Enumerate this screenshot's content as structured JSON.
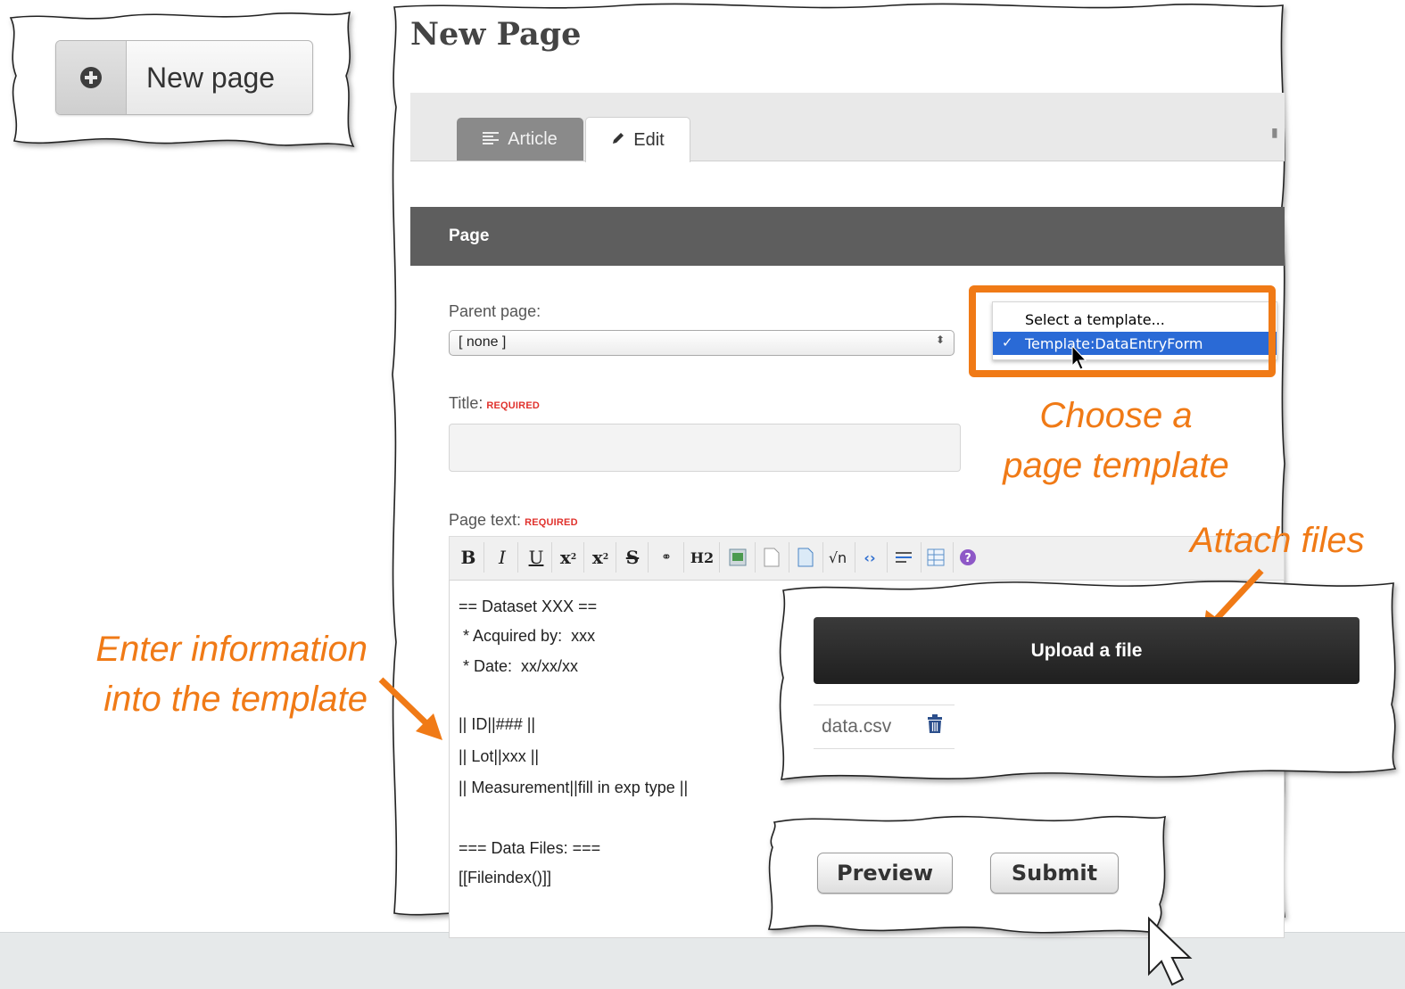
{
  "top_button": {
    "label": "New page",
    "icon": "plus-circle-icon"
  },
  "page": {
    "heading": "New Page",
    "tabs": [
      {
        "label": "Article",
        "icon": "article-lines-icon",
        "active": false
      },
      {
        "label": "Edit",
        "icon": "pencil-icon",
        "active": true
      }
    ],
    "section_title": "Page"
  },
  "form": {
    "parent_label": "Parent page:",
    "parent_value": "[ none ]",
    "title_label": "Title:",
    "title_required": "REQUIRED",
    "title_value": "",
    "text_label": "Page text:",
    "text_required": "REQUIRED",
    "toolbar": [
      "bold",
      "italic",
      "underline",
      "superscript",
      "subscript",
      "strikethrough",
      "link",
      "heading-2",
      "image",
      "page",
      "document",
      "math",
      "code",
      "horizontal-rule",
      "table",
      "help"
    ],
    "editor_lines": [
      "== Dataset XXX ==",
      " * Acquired by:  xxx",
      " * Date:  xx/xx/xx",
      "",
      "|| ID||### ||",
      "|| Lot||xxx ||",
      "|| Measurement||fill in exp type ||",
      "",
      "=== Data Files: ===",
      "[[Fileindex()]]"
    ],
    "preview_label": "Preview",
    "submit_label": "Submit"
  },
  "template_menu": {
    "placeholder": "Select a template...",
    "selected": "Template:DataEntryForm",
    "check": "✓"
  },
  "upload": {
    "button_label": "Upload a file",
    "files": [
      "data.csv"
    ]
  },
  "callouts": {
    "template_line1": "Choose a",
    "template_line2": "page template",
    "attach": "Attach files",
    "enter_line1": "Enter information",
    "enter_line2": "into the template"
  },
  "colors": {
    "accent_orange": "#f07a16",
    "selection_blue": "#2a6ad6",
    "header_gray": "#5e5e5e"
  }
}
